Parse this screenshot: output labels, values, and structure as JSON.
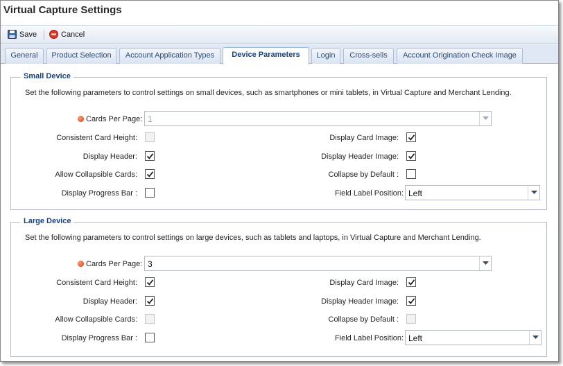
{
  "window": {
    "title": "Virtual Capture Settings"
  },
  "toolbar": {
    "save_label": "Save",
    "cancel_label": "Cancel"
  },
  "tabs": [
    {
      "label": "General"
    },
    {
      "label": "Product Selection"
    },
    {
      "label": "Account Application Types"
    },
    {
      "label": "Device Parameters",
      "active": true
    },
    {
      "label": "Login"
    },
    {
      "label": "Cross-sells"
    },
    {
      "label": "Account Origination Check Image"
    }
  ],
  "small_device": {
    "legend": "Small Device",
    "description": "Set the following parameters to control settings on small devices, such as smartphones or mini tablets, in Virtual Capture and Merchant Lending.",
    "cards_per_page": {
      "label": "Cards Per Page:",
      "value": "1",
      "disabled": true
    },
    "consistent_card_height": {
      "label": "Consistent Card Height:",
      "checked": false,
      "disabled": true
    },
    "display_header": {
      "label": "Display Header:",
      "checked": true
    },
    "allow_collapsible_cards": {
      "label": "Allow Collapsible Cards:",
      "checked": true
    },
    "display_progress_bar": {
      "label": "Display Progress Bar :",
      "checked": false
    },
    "display_card_image": {
      "label": "Display Card Image:",
      "checked": true
    },
    "display_header_image": {
      "label": "Display Header Image:",
      "checked": true
    },
    "collapse_by_default": {
      "label": "Collapse by Default :",
      "checked": false
    },
    "field_label_position": {
      "label": "Field Label Position:",
      "value": "Left"
    }
  },
  "large_device": {
    "legend": "Large Device",
    "description": "Set the following parameters to control settings on large devices, such as tablets and laptops, in Virtual Capture and Merchant Lending.",
    "cards_per_page": {
      "label": "Cards Per Page:",
      "value": "3",
      "disabled": false
    },
    "consistent_card_height": {
      "label": "Consistent Card Height:",
      "checked": true
    },
    "display_header": {
      "label": "Display Header:",
      "checked": true
    },
    "allow_collapsible_cards": {
      "label": "Allow Collapsible Cards:",
      "checked": false,
      "disabled": true
    },
    "display_progress_bar": {
      "label": "Display Progress Bar :",
      "checked": false
    },
    "display_card_image": {
      "label": "Display Card Image:",
      "checked": true
    },
    "display_header_image": {
      "label": "Display Header Image:",
      "checked": true
    },
    "collapse_by_default": {
      "label": "Collapse by Default :",
      "checked": false,
      "disabled": true
    },
    "field_label_position": {
      "label": "Field Label Position:",
      "value": "Left"
    }
  },
  "colors": {
    "accent": "#15428b",
    "tab_bg": "#dfe8f4",
    "required_dot": "#e0380c"
  }
}
